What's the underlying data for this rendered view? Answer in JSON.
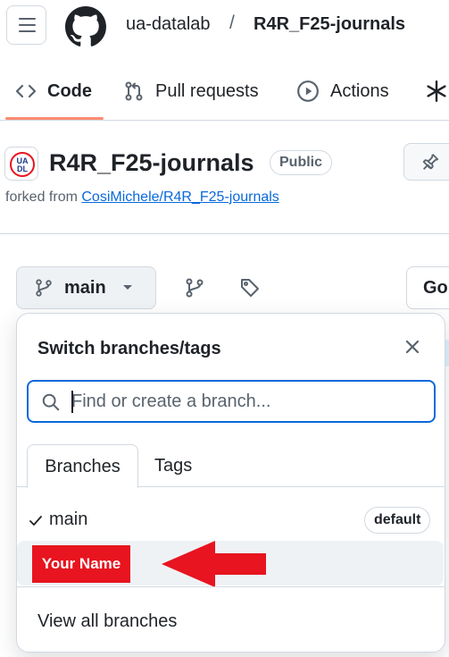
{
  "header": {
    "owner": "ua-datalab",
    "separator": "/",
    "repo": "R4R_F25-journals"
  },
  "tabs": [
    {
      "label": "Code",
      "icon": "code-icon",
      "selected": true
    },
    {
      "label": "Pull requests",
      "icon": "git-pull-request-icon"
    },
    {
      "label": "Actions",
      "icon": "play-icon"
    },
    {
      "label": "",
      "icon": "asterisk-icon"
    }
  ],
  "repo": {
    "title": "R4R_F25-journals",
    "visibility": "Public",
    "forked_prefix": "forked from",
    "forked_link": "CosiMichele/R4R_F25-journals",
    "avatar_text": "UA DL"
  },
  "toolbar": {
    "branch_label": "main",
    "go_label": "Go"
  },
  "branch_panel": {
    "title": "Switch branches/tags",
    "search_placeholder": "Find or create a branch...",
    "tabs": [
      "Branches",
      "Tags"
    ],
    "branches": [
      {
        "name": "main",
        "checked": true,
        "badge": "default"
      },
      {
        "name": "Your Name",
        "highlight_color": "#e8141f"
      }
    ],
    "footer_link": "View all branches"
  },
  "colors": {
    "accent": "#0969da",
    "tab_underline": "#fd8c73",
    "annotation_red": "#e8141f"
  }
}
